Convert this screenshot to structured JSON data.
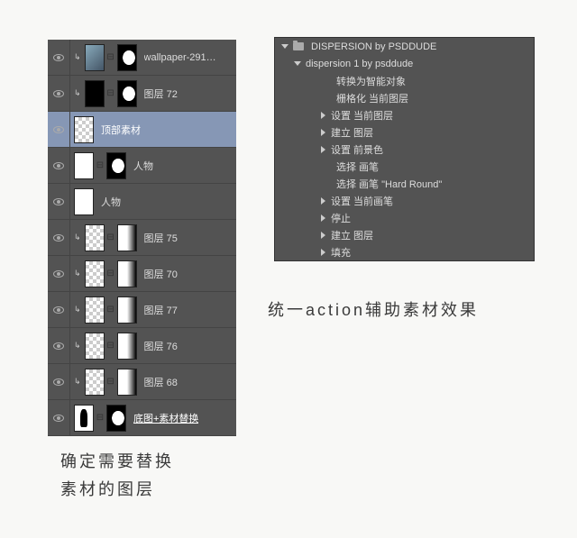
{
  "layers_panel": {
    "layers": [
      {
        "name": "wallpaper-291…",
        "clipped": true,
        "linked": true,
        "mask": "white",
        "thumb": "photo"
      },
      {
        "name": "图层 72",
        "clipped": true,
        "linked": true,
        "mask": "white-small",
        "thumb": "mask-black"
      },
      {
        "name": "顶部素材",
        "clipped": false,
        "linked": false,
        "mask": null,
        "thumb": "checker",
        "selected": true
      },
      {
        "name": "人物",
        "clipped": false,
        "linked": true,
        "mask": "white-small",
        "thumb": "figure"
      },
      {
        "name": "人物",
        "clipped": false,
        "linked": false,
        "mask": null,
        "thumb": "figure"
      },
      {
        "name": "图层 75",
        "clipped": true,
        "linked": true,
        "mask": "gradient",
        "thumb": "checker"
      },
      {
        "name": "图层 70",
        "clipped": true,
        "linked": true,
        "mask": "gradient",
        "thumb": "checker-gold"
      },
      {
        "name": "图层 77",
        "clipped": true,
        "linked": true,
        "mask": "gradient",
        "thumb": "checker-dark"
      },
      {
        "name": "图层 76",
        "clipped": true,
        "linked": true,
        "mask": "gradient",
        "thumb": "checker-teal"
      },
      {
        "name": "图层 68",
        "clipped": true,
        "linked": true,
        "mask": "gradient",
        "thumb": "checker-teal2"
      },
      {
        "name": "底图+素材替换",
        "clipped": false,
        "linked": true,
        "mask": "white",
        "thumb": "silhouette",
        "underline": true
      }
    ]
  },
  "actions_panel": {
    "folder": "DISPERSION by PSDDUDE",
    "action_set": "dispersion 1 by psddude",
    "steps": [
      {
        "label": "转换为智能对象",
        "arrow": false
      },
      {
        "label": "栅格化 当前图层",
        "arrow": false
      },
      {
        "label": "设置 当前图层",
        "arrow": true
      },
      {
        "label": "建立 图层",
        "arrow": true
      },
      {
        "label": "设置 前景色",
        "arrow": true
      },
      {
        "label": "选择 画笔",
        "arrow": false
      },
      {
        "label": "选择 画笔 \"Hard Round\"",
        "arrow": false
      },
      {
        "label": "设置 当前画笔",
        "arrow": true
      },
      {
        "label": "停止",
        "arrow": true
      },
      {
        "label": "建立 图层",
        "arrow": true
      },
      {
        "label": "填充",
        "arrow": true
      }
    ]
  },
  "captions": {
    "left_line1": "确定需要替换",
    "left_line2": "素材的图层",
    "right": "统一action辅助素材效果"
  }
}
